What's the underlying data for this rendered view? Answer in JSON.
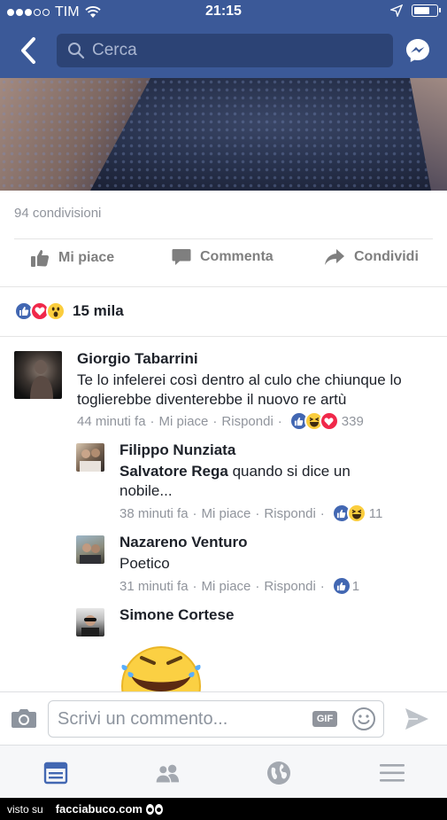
{
  "status_bar": {
    "carrier": "TIM",
    "time": "21:15",
    "battery_level": 0.75
  },
  "nav": {
    "search_placeholder": "Cerca"
  },
  "post": {
    "shares": "94 condivisioni",
    "actions": {
      "like": "Mi piace",
      "comment": "Commenta",
      "share": "Condividi"
    },
    "reactions": {
      "icons": [
        "like-icon",
        "love-icon",
        "wow-icon"
      ],
      "count": "15 mila"
    }
  },
  "comments": [
    {
      "name": "Giorgio Tabarrini",
      "text": "Te lo infelerei così dentro al culo che chiunque lo toglierebbe diventerebbe il nuovo re artù",
      "time": "44 minuti fa",
      "like": "Mi piace",
      "reply": "Rispondi",
      "reaction_count": "339"
    },
    {
      "name": "Filippo Nunziata",
      "tag": "Salvatore Rega",
      "text": " quando si dice un nobile...",
      "time": "38 minuti fa",
      "like": "Mi piace",
      "reply": "Rispondi",
      "reaction_count": "11"
    },
    {
      "name": "Nazareno Venturo",
      "text": "Poetico",
      "time": "31 minuti fa",
      "like": "Mi piace",
      "reply": "Rispondi",
      "reaction_count": "1"
    },
    {
      "name": "Simone Cortese"
    }
  ],
  "composer": {
    "placeholder": "Scrivi un commento...",
    "gif_label": "GIF"
  },
  "tabs": [
    "feed-icon",
    "friends-icon",
    "globe-icon",
    "menu-icon"
  ],
  "footer": {
    "prefix": "visto su",
    "brand": "facciabuco.com"
  },
  "colors": {
    "brand": "#3b5998",
    "active_tab": "#4267b2",
    "meta_text": "#90949c"
  }
}
